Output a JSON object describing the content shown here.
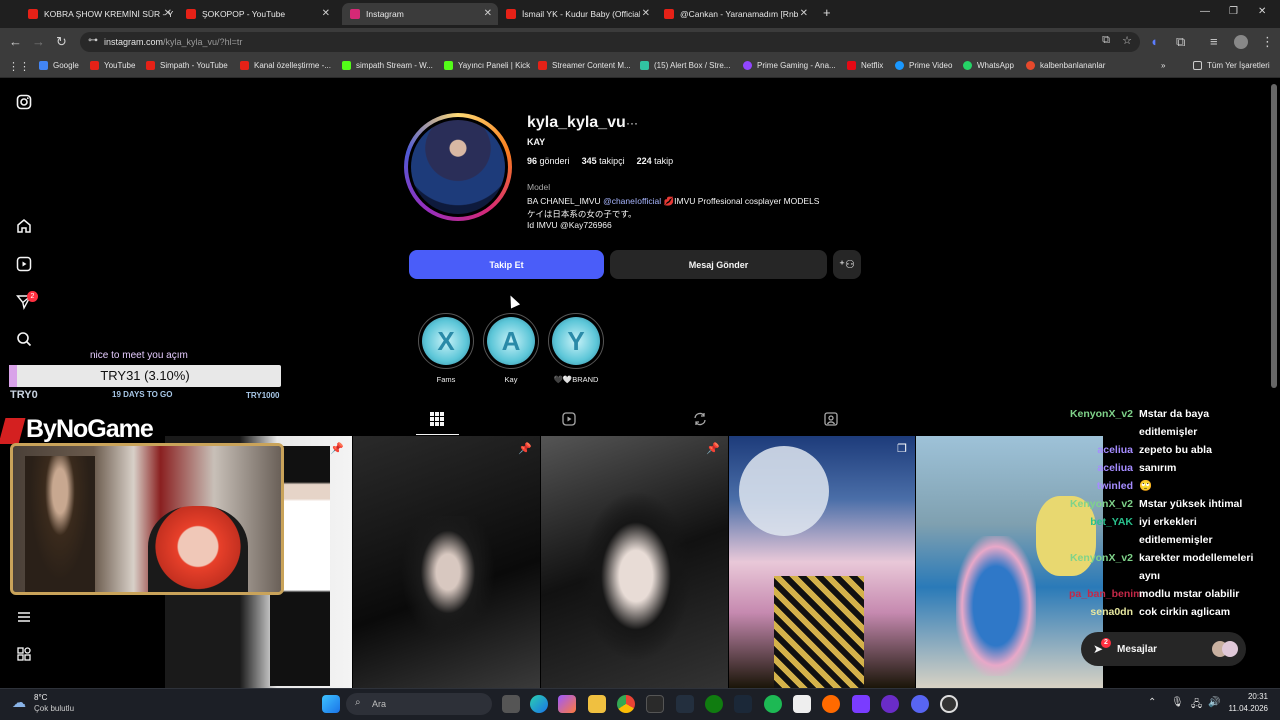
{
  "browser": {
    "tabs": [
      {
        "title": "KOBRA ŞHOW KREMİNİ SÜR - Y",
        "color": "#e62117"
      },
      {
        "title": "ŞOKOPOP - YouTube",
        "color": "#e62117"
      },
      {
        "title": "Instagram",
        "color": "#d62976"
      },
      {
        "title": "İsmail YK - Kudur Baby (Official",
        "color": "#e62117"
      },
      {
        "title": "@Cankan - Yaranamadım [Rnb",
        "color": "#e62117"
      }
    ],
    "url_host": "instagram.com",
    "url_path": "/kyla_kyla_vu/?hl=tr",
    "bookmarks": [
      {
        "label": "Google",
        "color": "#4285f4"
      },
      {
        "label": "YouTube",
        "color": "#e62117"
      },
      {
        "label": "Simpath - YouTube",
        "color": "#e62117"
      },
      {
        "label": "Kanal özelleştirme -...",
        "color": "#e62117"
      },
      {
        "label": "simpath Stream - W...",
        "color": "#53fc18"
      },
      {
        "label": "Yayıncı Paneli | Kick",
        "color": "#53fc18"
      },
      {
        "label": "Streamer Content M...",
        "color": "#e62117"
      },
      {
        "label": "(15) Alert Box / Stre...",
        "color": "#31c3a2"
      },
      {
        "label": "Prime Gaming - Ana...",
        "color": "#9146ff"
      },
      {
        "label": "Netflix",
        "color": "#e50914"
      },
      {
        "label": "Prime Video",
        "color": "#1a98ff"
      },
      {
        "label": "WhatsApp",
        "color": "#25d366"
      },
      {
        "label": "kalbenbanlananlar",
        "color": "#e6492c"
      }
    ],
    "all_bookmarks": "Tüm Yer İşaretleri"
  },
  "profile": {
    "username": "kyla_kyla_vu",
    "fullname": "KAY",
    "posts_count": "96",
    "posts_label": "gönderi",
    "followers_count": "345",
    "followers_label": "takipçi",
    "following_count": "224",
    "following_label": "takip",
    "category": "Model",
    "bio_line1_a": "BA CHANEL_IMVU",
    "bio_line1_link": "@chaneIofficial",
    "bio_line1_b": "💋IMVU Proffesional cosplayer MODELS",
    "bio_line2": "ケイは日本系の女の子です。",
    "bio_line3": "Id IMVU @Kay726966",
    "follow_button": "Takip Et",
    "message_button": "Mesaj Gönder",
    "highlights": [
      {
        "label": "Fams",
        "letter": "X"
      },
      {
        "label": "Kay",
        "letter": "A"
      },
      {
        "label": "🖤🤍BRAND",
        "letter": "Y"
      }
    ]
  },
  "sidebar": {
    "notif_badge": "2"
  },
  "stream_overlay": {
    "goal_title": "nice to meet you açım",
    "goal_progress": "TRY31 (3.10%)",
    "goal_fraction": 0.031,
    "goal_start": "TRY0",
    "goal_days": "19 DAYS TO GO",
    "goal_target": "TRY1000",
    "brand": "ByNoGame"
  },
  "chat": [
    {
      "user": "KenyonX_v2",
      "text": "Mstar da baya",
      "color": "#7fd38a"
    },
    {
      "user": "",
      "text": "editlemişler",
      "color": "#7fd38a"
    },
    {
      "user": "aceliua",
      "text": "zepeto bu abla",
      "color": "#a58cff"
    },
    {
      "user": "aceliua",
      "text": "sanırım",
      "color": "#a58cff"
    },
    {
      "user": "twinled",
      "text": "🙄",
      "color": "#a58cff"
    },
    {
      "user": "KenyonX_v2",
      "text": "Mstar yüksek ihtimal",
      "color": "#7fd38a"
    },
    {
      "user": "bet_YAK",
      "text": "iyi erkekleri",
      "color": "#29c08c"
    },
    {
      "user": "",
      "text": "editlememişler",
      "color": "#29c08c"
    },
    {
      "user": "KenyonX_v2",
      "text": "karekter modellemeleri",
      "color": "#7fd38a"
    },
    {
      "user": "",
      "text": "aynı",
      "color": "#7fd38a"
    },
    {
      "user": "pa_ban_benim",
      "text": "modlu mstar olabilir",
      "color": "#c42848"
    },
    {
      "user": "sena0dn",
      "text": "cok cirkin aglicam",
      "color": "#e8e8a0"
    }
  ],
  "messages": {
    "label": "Mesajlar",
    "badge": "2"
  },
  "taskbar": {
    "weather_temp": "8°C",
    "weather_desc": "Çok bulutlu",
    "search_placeholder": "Ara",
    "time": "20:31",
    "date": "11.04.2026"
  }
}
